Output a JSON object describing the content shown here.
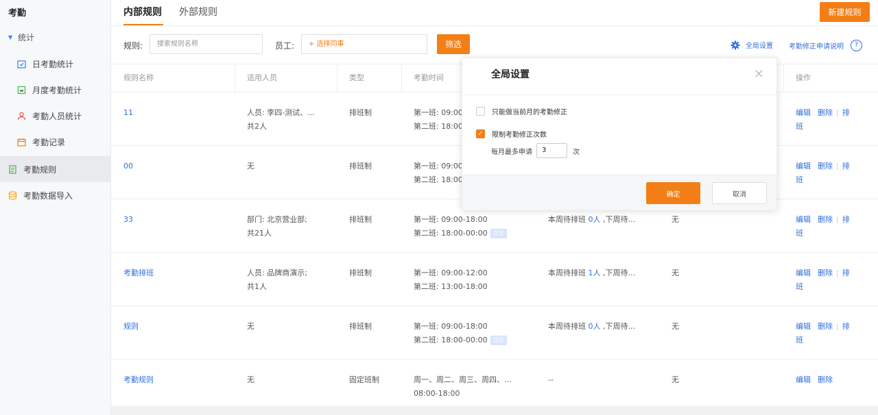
{
  "sidebar": {
    "title": "考勤",
    "group": "统计",
    "items": [
      {
        "label": "日考勤统计",
        "icon": "calendar-check-icon"
      },
      {
        "label": "月度考勤统计",
        "icon": "month-report-icon"
      },
      {
        "label": "考勤人员统计",
        "icon": "person-icon"
      },
      {
        "label": "考勤记录",
        "icon": "calendar-icon"
      },
      {
        "label": "考勤规则",
        "icon": "rules-icon"
      },
      {
        "label": "考勤数据导入",
        "icon": "import-icon"
      }
    ]
  },
  "tabs": {
    "internal": "内部规则",
    "external": "外部规则"
  },
  "toolbar": {
    "new_rule": "新建规则"
  },
  "filter": {
    "rule_label": "规则:",
    "rule_placeholder": "搜索规则名称",
    "employee_label": "员工:",
    "employee_placeholder": "+ 选择同事",
    "filter_button": "筛选",
    "global_settings": "全局设置",
    "help_link": "考勤修正申请说明",
    "help_icon": "?"
  },
  "table": {
    "headers": [
      "规则名称",
      "适用人员",
      "类型",
      "考勤时间",
      "",
      "",
      "操作"
    ],
    "rows": [
      {
        "name": "11",
        "people1": "人员: 李四-测试、...",
        "people2": "共2人",
        "type": "排班制",
        "time1": "第一班: 09:00",
        "time2": "第二班: 18:00",
        "tag": "",
        "pending_pre": "",
        "pending_num": "",
        "pending_post": "",
        "exception": "",
        "op_edit": "编辑",
        "op_delete": "删除",
        "op_schedule1": "排",
        "op_schedule2": "班"
      },
      {
        "name": "00",
        "people1": "无",
        "people2": "",
        "type": "排班制",
        "time1": "第一班: 09:00",
        "time2": "第二班: 18:00",
        "tag": "",
        "pending_pre": "",
        "pending_num": "",
        "pending_post": "",
        "exception": "",
        "op_edit": "编辑",
        "op_delete": "删除",
        "op_schedule1": "排",
        "op_schedule2": "班"
      },
      {
        "name": "33",
        "people1": "部门: 北京营业部;",
        "people2": "共21人",
        "type": "排班制",
        "time1": "第一班: 09:00-18:00",
        "time2": "第二班: 18:00-00:00",
        "tag": "次日",
        "pending_pre": "本周待排班 ",
        "pending_num": "0人",
        "pending_post": " ,下周待...",
        "exception": "无",
        "op_edit": "编辑",
        "op_delete": "删除",
        "op_schedule1": "排",
        "op_schedule2": "班"
      },
      {
        "name": "考勤排班",
        "people1": "人员: 品牌商演示;",
        "people2": "共1人",
        "type": "排班制",
        "time1": "第一班: 09:00-12:00",
        "time2": "第二班: 13:00-18:00",
        "tag": "",
        "pending_pre": "本周待排班 ",
        "pending_num": "1人",
        "pending_post": " ,下周待...",
        "exception": "无",
        "op_edit": "编辑",
        "op_delete": "删除",
        "op_schedule1": "排",
        "op_schedule2": "班"
      },
      {
        "name": "规则",
        "people1": "无",
        "people2": "",
        "type": "排班制",
        "time1": "第一班: 09:00-18:00",
        "time2": "第二班: 18:00-00:00",
        "tag": "次日",
        "pending_pre": "本周待排班 ",
        "pending_num": "0人",
        "pending_post": " ,下周待...",
        "exception": "无",
        "op_edit": "编辑",
        "op_delete": "删除",
        "op_schedule1": "排",
        "op_schedule2": "班"
      },
      {
        "name": "考勤规则",
        "people1": "无",
        "people2": "",
        "type": "固定班制",
        "time1": "周一、周二、周三、周四、...",
        "time2": "08:00-18:00",
        "tag": "",
        "pending_pre": "--",
        "pending_num": "",
        "pending_post": "",
        "exception": "无",
        "op_edit": "编辑",
        "op_delete": "删除",
        "op_schedule1": "",
        "op_schedule2": ""
      }
    ]
  },
  "modal": {
    "title": "全局设置",
    "close_icon": "×",
    "option1": "只能做当前月的考勤修正",
    "option1_checked": false,
    "option2": "限制考勤修正次数",
    "option2_checked": true,
    "check_mark": "✓",
    "limit_prefix": "每月最多申请",
    "limit_value": "3",
    "limit_suffix": "次",
    "ok": "确定",
    "cancel": "取消"
  }
}
